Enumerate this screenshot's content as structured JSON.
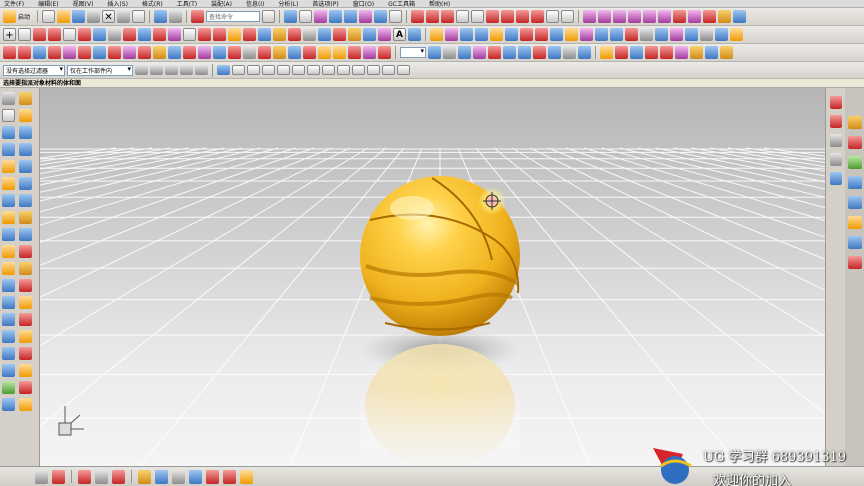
{
  "menu": [
    "文件(F)",
    "编辑(E)",
    "视图(V)",
    "插入(S)",
    "格式(R)",
    "工具(T)",
    "装配(A)",
    "信息(I)",
    "分析(L)",
    "首选项(P)",
    "窗口(O)",
    "GC工具箱",
    "帮助(H)"
  ],
  "toolbar": {
    "start_label": "启动",
    "search_placeholder": "查找命令",
    "selection_filter": "没有选择过滤器",
    "selection_scope": "仅在工作部件内"
  },
  "status": {
    "prompt": "选择要指派对象材料的体和面"
  },
  "overlay": {
    "group_text": "UG 学习群 689391319",
    "welcome_text": "欢迎你的加入"
  },
  "icons": {
    "left": [
      "cube-icon",
      "sphere-icon",
      "cylinder-icon",
      "extrude-icon",
      "revolve-icon",
      "hole-icon",
      "blend-icon",
      "chamfer-icon",
      "shell-icon",
      "draft-icon",
      "mirror-icon",
      "pattern-icon",
      "boolean-icon",
      "trim-icon",
      "sketch-icon",
      "datum-icon"
    ],
    "right": [
      "first-frame-icon",
      "prev-frame-icon",
      "play-icon",
      "next-frame-icon",
      "last-frame-icon"
    ],
    "resource": [
      "assembly-navigator-icon",
      "part-navigator-icon",
      "history-icon",
      "reuse-library-icon",
      "web-browser-icon",
      "palette-icon",
      "roles-icon",
      "system-materials-icon"
    ]
  },
  "colors": {
    "ball": "#f0b21e",
    "floor": "#ececec",
    "accent": "#3e77c2"
  }
}
